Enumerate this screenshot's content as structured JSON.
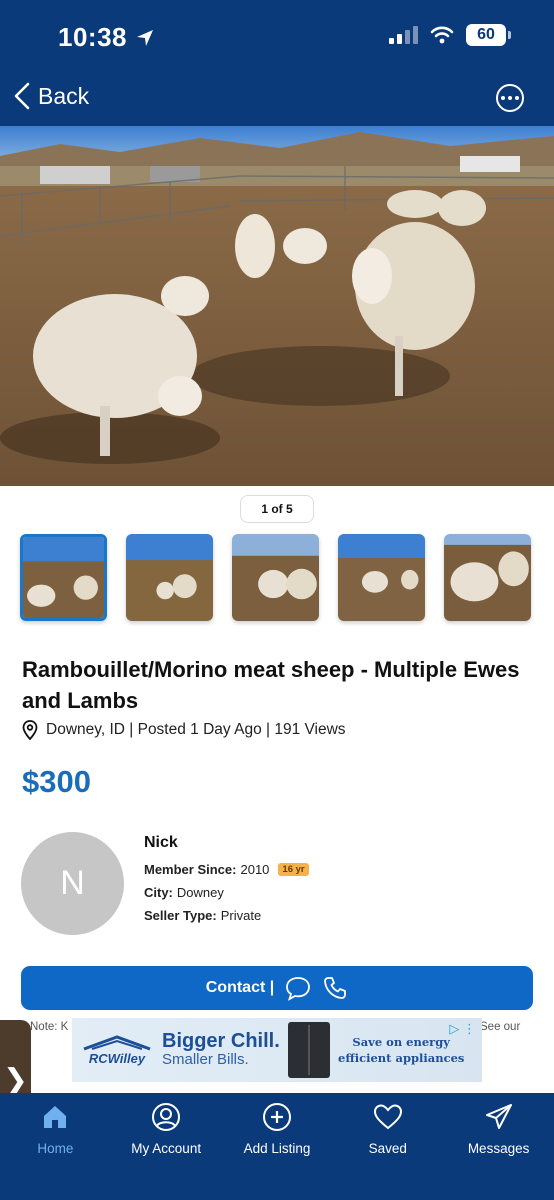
{
  "status": {
    "time": "10:38",
    "battery": "60"
  },
  "header": {
    "back_label": "Back"
  },
  "photo": {
    "counter": "1 of 5",
    "thumbnails": 5
  },
  "listing": {
    "title": "Rambouillet/Morino meat sheep - Multiple Ewes and Lambs",
    "meta": "Downey, ID | Posted 1 Day Ago | 191 Views",
    "price": "$300"
  },
  "seller": {
    "initial": "N",
    "name": "Nick",
    "member_since_label": "Member Since:",
    "member_since": "2010",
    "badge": "16 yr",
    "city_label": "City:",
    "city": "Downey",
    "type_label": "Seller Type:",
    "type": "Private"
  },
  "contact": {
    "label": "Contact |"
  },
  "note": {
    "left": "Note: K",
    "right": "See our"
  },
  "ad": {
    "brand": "RCWilley",
    "headline": "Bigger Chill.",
    "subline": "Smaller Bills.",
    "cta_line1": "Save on energy",
    "cta_line2": "efficient appliances"
  },
  "nav": {
    "items": [
      {
        "label": "Home"
      },
      {
        "label": "My Account"
      },
      {
        "label": "Add Listing"
      },
      {
        "label": "Saved"
      },
      {
        "label": "Messages"
      }
    ]
  },
  "colors": {
    "brand_navy": "#0b3a7a",
    "accent_blue": "#1068c6",
    "price_blue": "#1a6dba",
    "badge_orange": "#f6b24a"
  }
}
